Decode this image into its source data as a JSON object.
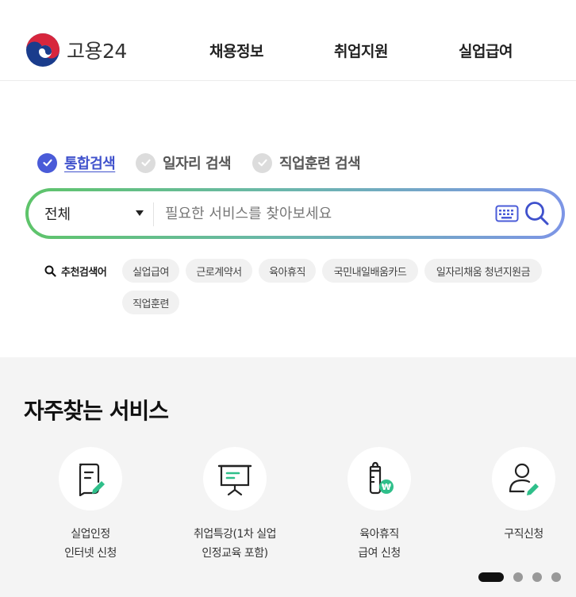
{
  "header": {
    "logo_text": "고용24",
    "nav": [
      "채용정보",
      "취업지원",
      "실업급여"
    ]
  },
  "search": {
    "tabs": [
      {
        "label": "통합검색",
        "active": true
      },
      {
        "label": "일자리 검색",
        "active": false
      },
      {
        "label": "직업훈련 검색",
        "active": false
      }
    ],
    "category_selected": "전체",
    "placeholder": "필요한 서비스를 찾아보세요",
    "value": ""
  },
  "recommended": {
    "label": "추천검색어",
    "keywords": [
      "실업급여",
      "근로계약서",
      "육아휴직",
      "국민내일배움카드",
      "일자리채움 청년지원금",
      "직업훈련"
    ]
  },
  "services": {
    "title": "자주찾는 서비스",
    "items": [
      {
        "line1": "실업인정",
        "line2": "인터넷 신청",
        "icon": "document-edit-icon"
      },
      {
        "line1": "취업특강(1차 실업",
        "line2": "인정교육 포함)",
        "icon": "presentation-board-icon"
      },
      {
        "line1": "육아휴직",
        "line2": "급여 신청",
        "icon": "baby-bottle-icon"
      },
      {
        "line1": "구직신청",
        "line2": "",
        "icon": "user-edit-icon"
      }
    ],
    "pager": {
      "count": 4,
      "active": 0
    }
  },
  "colors": {
    "accent": "#4a5bd8",
    "gradient_start": "#5ec46a",
    "gradient_end": "#7d95e6",
    "icon_green": "#2fbf8a"
  }
}
